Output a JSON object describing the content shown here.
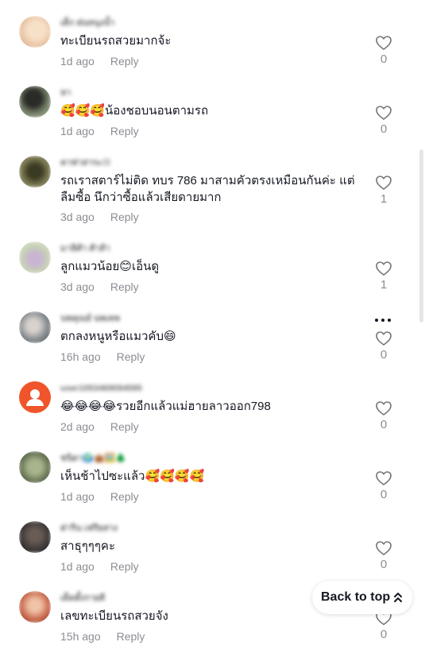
{
  "comments": [
    {
      "username": "เด็ก ฝนหนุงน้ำ",
      "text": "ทะเบียนรถสวยมากจ้ะ",
      "time": "1d ago",
      "reply": "Reply",
      "likes": "0",
      "avatar_color": "#e9c6a6"
    },
    {
      "username": "หา",
      "text": "🥰🥰🥰น้องชอบนอนตามรถ",
      "time": "1d ago",
      "reply": "Reply",
      "likes": "0",
      "avatar_color": "#5a6a58"
    },
    {
      "username": "คาฟาสาระ😢",
      "text": "รถเราสตาร์ไม่ติด ทบร 786 มาสามคัวตรงเหมือนกันค่ะ แต่ลืมซื้อ นึกว่าซื้อแล้วเสียดายมาก",
      "time": "3d ago",
      "reply": "Reply",
      "likes": "1",
      "avatar_color": "#6b6a4a"
    },
    {
      "username": "มาลิศ้า ศ้าส้า",
      "text": "ลูกแมวน้อย😊เอ็นดู",
      "time": "3d ago",
      "reply": "Reply",
      "likes": "1",
      "avatar_color": "#b9c7a8"
    },
    {
      "username": "นพคุณย์ นพเคพ",
      "text": "ตกลงหนูหรือแมวคับ😄",
      "time": "16h ago",
      "reply": "Reply",
      "likes": "0",
      "avatar_color": "#8a8f93"
    },
    {
      "username": "user1053469094595",
      "text": "😂😂😂😂รวยอีกแล้วแม่ฮายลาวออก798",
      "time": "2d ago",
      "reply": "Reply",
      "likes": "0",
      "avatar_color": "#f0542b"
    },
    {
      "username": "ชนิดา🌍👜🖼️🌲",
      "text": "เห็นช้าไปซะแล้ว🥰🥰🥰🥰",
      "time": "1d ago",
      "reply": "Reply",
      "likes": "0",
      "avatar_color": "#7d8a6a"
    },
    {
      "username": "ต่าริน เฟรียสาง",
      "text": "สาธุๆๆๆคะ",
      "time": "1d ago",
      "reply": "Reply",
      "likes": "0",
      "avatar_color": "#3c3838"
    },
    {
      "username": "เด็ดตั้งรายดี",
      "text": "เลขทะเบียนรถสวยจัง",
      "time": "15h ago",
      "reply": "Reply",
      "likes": "0",
      "avatar_color": "#c9684c"
    }
  ],
  "back_to_top": "Back to top"
}
